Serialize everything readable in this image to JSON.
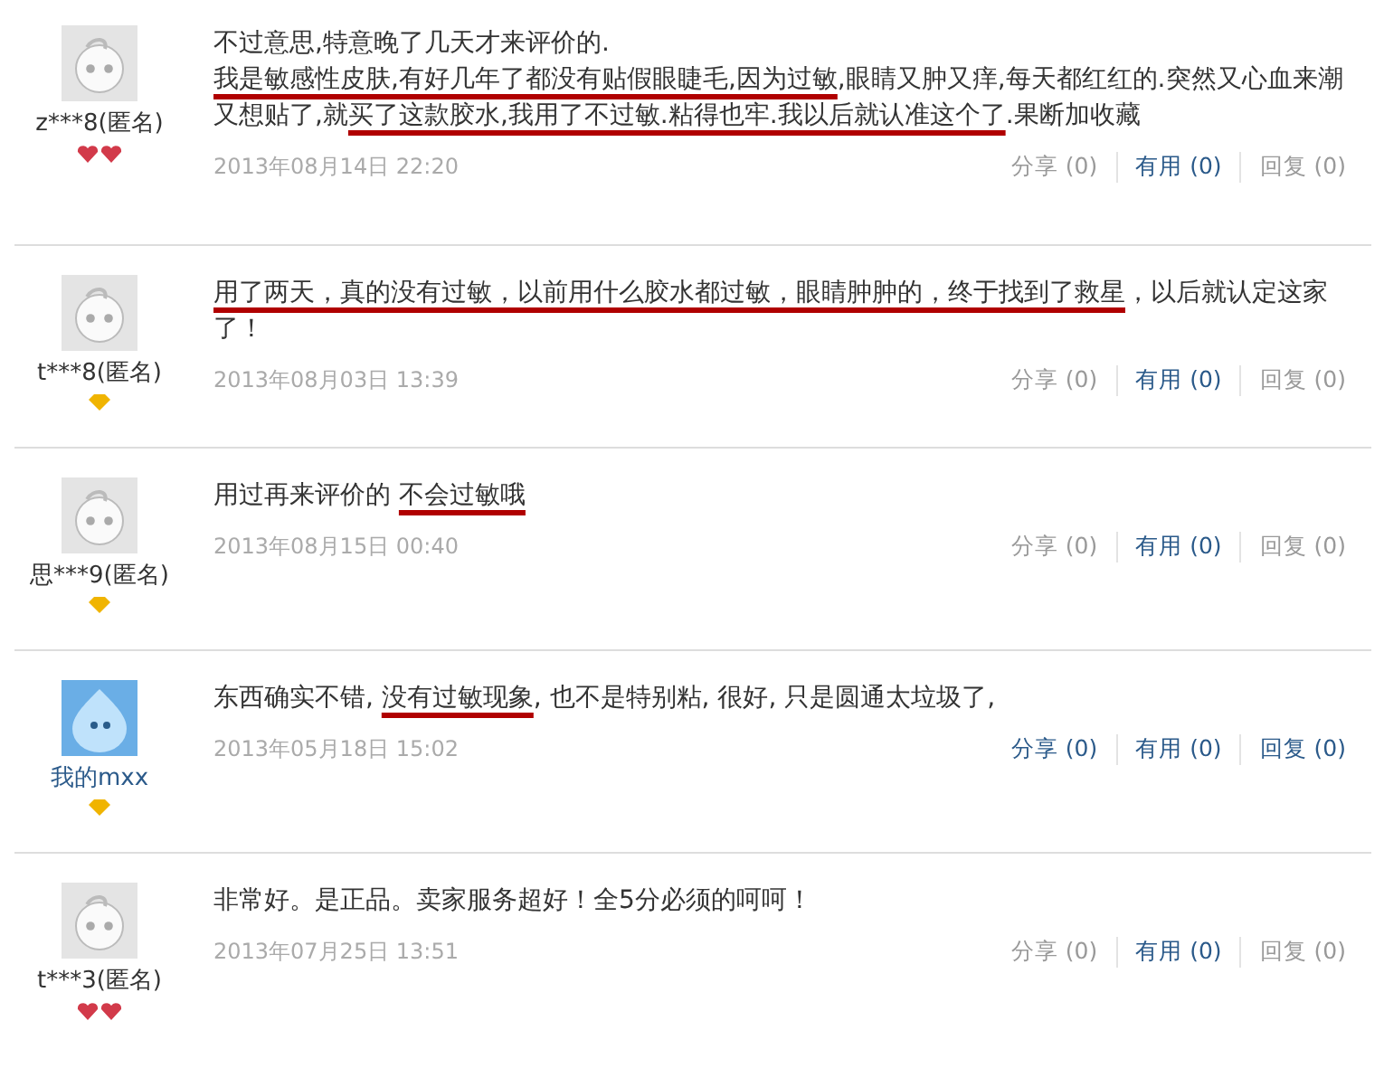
{
  "reviews": [
    {
      "user": {
        "name": "z***8(匿名)",
        "avatar": {
          "kind": "default"
        },
        "linked": false,
        "badge": {
          "kind": "hearts"
        }
      },
      "paragraphs": [
        [
          {
            "text": "不过意思,特意晚了几天才来评价的.",
            "marked": false
          }
        ],
        [
          {
            "text": "我是敏感性皮肤,有好几年了都没有贴假眼睫毛,因为过敏",
            "marked": true
          },
          {
            "text": ",眼睛又肿又痒,每天都红红的.突然又心血来潮又想贴了,就",
            "marked": false
          },
          {
            "text": "买了这款胶水,我用了不过敏.粘得也牢.我以后就认准这个了",
            "marked": true
          },
          {
            "text": ".果断加收藏",
            "marked": false
          }
        ]
      ],
      "date": "2013年08月14日 22:20",
      "actions": [
        {
          "label": "分享 (0)",
          "active": false
        },
        {
          "label": "有用 (0)",
          "active": true
        },
        {
          "label": "回复 (0)",
          "active": false
        }
      ]
    },
    {
      "user": {
        "name": "t***8(匿名)",
        "avatar": {
          "kind": "default"
        },
        "linked": false,
        "badge": {
          "kind": "diamond"
        }
      },
      "paragraphs": [
        [
          {
            "text": "用了两天，真的没有过敏，以前用什么胶水都过敏，眼睛肿肿的，终于找到了救星",
            "marked": true
          },
          {
            "text": "，以后就认定这家了！",
            "marked": false
          }
        ]
      ],
      "date": "2013年08月03日 13:39",
      "actions": [
        {
          "label": "分享 (0)",
          "active": false
        },
        {
          "label": "有用 (0)",
          "active": true
        },
        {
          "label": "回复 (0)",
          "active": false
        }
      ]
    },
    {
      "user": {
        "name": "思***9(匿名)",
        "avatar": {
          "kind": "default"
        },
        "linked": false,
        "badge": {
          "kind": "diamond"
        }
      },
      "paragraphs": [
        [
          {
            "text": "用过再来评价的 ",
            "marked": false
          },
          {
            "text": "不会过敏哦",
            "marked": true
          }
        ]
      ],
      "date": "2013年08月15日 00:40",
      "actions": [
        {
          "label": "分享 (0)",
          "active": false
        },
        {
          "label": "有用 (0)",
          "active": true
        },
        {
          "label": "回复 (0)",
          "active": false
        }
      ]
    },
    {
      "user": {
        "name": "我的mxx",
        "avatar": {
          "kind": "blue"
        },
        "linked": true,
        "badge": {
          "kind": "diamond"
        }
      },
      "paragraphs": [
        [
          {
            "text": "东西确实不错, ",
            "marked": false
          },
          {
            "text": "没有过敏现象",
            "marked": true
          },
          {
            "text": ", 也不是特别粘, 很好, 只是圆通太垃圾了,",
            "marked": false
          }
        ]
      ],
      "date": "2013年05月18日 15:02",
      "actions": [
        {
          "label": "分享 (0)",
          "active": true
        },
        {
          "label": "有用 (0)",
          "active": true
        },
        {
          "label": "回复 (0)",
          "active": true
        }
      ]
    },
    {
      "user": {
        "name": "t***3(匿名)",
        "avatar": {
          "kind": "default"
        },
        "linked": false,
        "badge": {
          "kind": "hearts"
        }
      },
      "paragraphs": [
        [
          {
            "text": "非常好。是正品。卖家服务超好！全5分必须的呵呵！",
            "marked": false
          }
        ]
      ],
      "date": "2013年07月25日 13:51",
      "actions": [
        {
          "label": "分享 (0)",
          "active": false
        },
        {
          "label": "有用 (0)",
          "active": true
        },
        {
          "label": "回复 (0)",
          "active": false
        }
      ]
    }
  ]
}
